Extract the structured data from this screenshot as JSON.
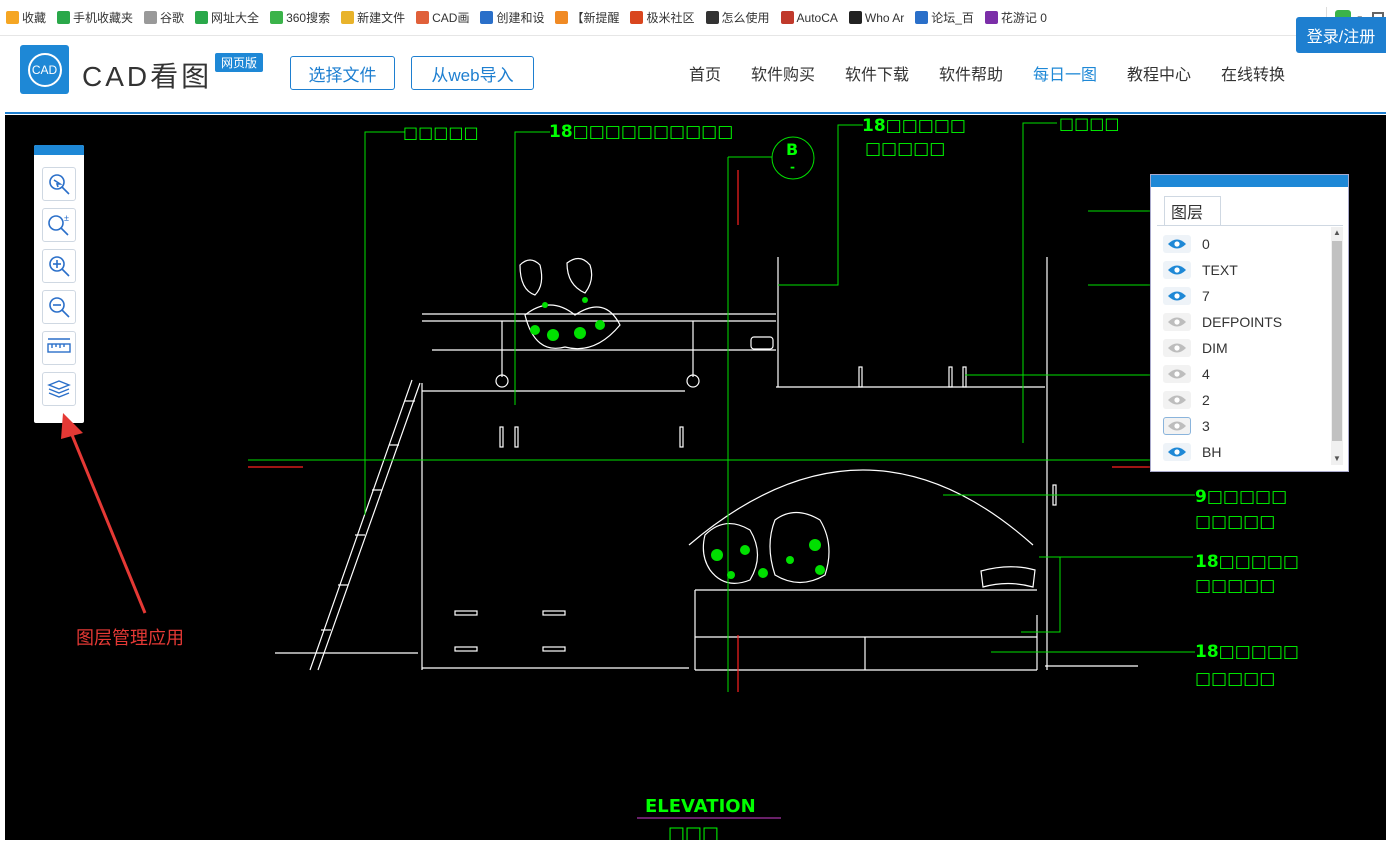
{
  "favorites": [
    {
      "label": "收藏",
      "icon": "star-icon",
      "color": "#f5a623"
    },
    {
      "label": "手机收藏夹",
      "icon": "phone-icon",
      "color": "#2aa84a"
    },
    {
      "label": "谷歌",
      "icon": "page-icon",
      "color": "#999999"
    },
    {
      "label": "网址大全",
      "icon": "plus-globe-icon",
      "color": "#2aa84a"
    },
    {
      "label": "360搜索",
      "icon": "search-circle-icon",
      "color": "#3bb34a"
    },
    {
      "label": "新建文件",
      "icon": "folder-icon",
      "color": "#e8b32b"
    },
    {
      "label": "CAD画",
      "icon": "cad-icon",
      "color": "#e0603a"
    },
    {
      "label": "创建和设",
      "icon": "edge-icon",
      "color": "#2a6fc9"
    },
    {
      "label": "【新提醒",
      "icon": "swirl-icon",
      "color": "#f08a24"
    },
    {
      "label": "极米社区",
      "icon": "x-icon",
      "color": "#d9461e"
    },
    {
      "label": "怎么使用",
      "icon": "plus-box-icon",
      "color": "#333333"
    },
    {
      "label": "AutoCA",
      "icon": "autocad-icon",
      "color": "#c0392b"
    },
    {
      "label": "Who Ar",
      "icon": "who-icon",
      "color": "#222222"
    },
    {
      "label": "论坛_百",
      "icon": "paw-icon",
      "color": "#2a6fc9"
    },
    {
      "label": "花游记 0",
      "icon": "flower-icon",
      "color": "#7b2ea8"
    }
  ],
  "header": {
    "logo_mark": "CAD",
    "logo_text": "CAD看图",
    "badge": "网页版",
    "select_file": "选择文件",
    "import_web": "从web导入",
    "nav": [
      "首页",
      "软件购买",
      "软件下载",
      "软件帮助",
      "每日一图",
      "教程中心",
      "在线转换"
    ],
    "active_nav": "每日一图",
    "login": "登录/注册"
  },
  "toolbox": {
    "tools": [
      "locate-icon",
      "zoom-extents-icon",
      "zoom-in-icon",
      "zoom-out-icon",
      "measure-icon",
      "layers-icon"
    ]
  },
  "layer_panel": {
    "tab": "图层",
    "layers": [
      {
        "name": "0",
        "visible": true
      },
      {
        "name": "TEXT",
        "visible": true
      },
      {
        "name": "7",
        "visible": true
      },
      {
        "name": "DEFPOINTS",
        "visible": false
      },
      {
        "name": "DIM",
        "visible": false
      },
      {
        "name": "4",
        "visible": false
      },
      {
        "name": "2",
        "visible": false
      },
      {
        "name": "3",
        "visible": false,
        "selected": true
      },
      {
        "name": "BH",
        "visible": true
      }
    ]
  },
  "drawing": {
    "labels": {
      "top_left": "□□□□□",
      "top_center": "18□□□□□□□□□□",
      "top_right_1": "18□□□□□",
      "top_right_2": "□□□□□",
      "top_far_right": "□□□□",
      "section_mark": "B",
      "section_sub": "-",
      "right_1a": "9□□□□□",
      "right_1b": "□□□□□",
      "right_2a": "18□□□□□",
      "right_2b": "□□□□□",
      "right_3a": "18□□□□□",
      "right_3b": "□□□□□",
      "elevation": "ELEVATION",
      "elevation_sub": "□□□"
    },
    "colors": {
      "text": "#00ff00",
      "lines": "#ffffff",
      "leader": "#00e000",
      "red": "#ff2020",
      "magenta": "#d040d0"
    }
  },
  "annotation": "图层管理应用"
}
